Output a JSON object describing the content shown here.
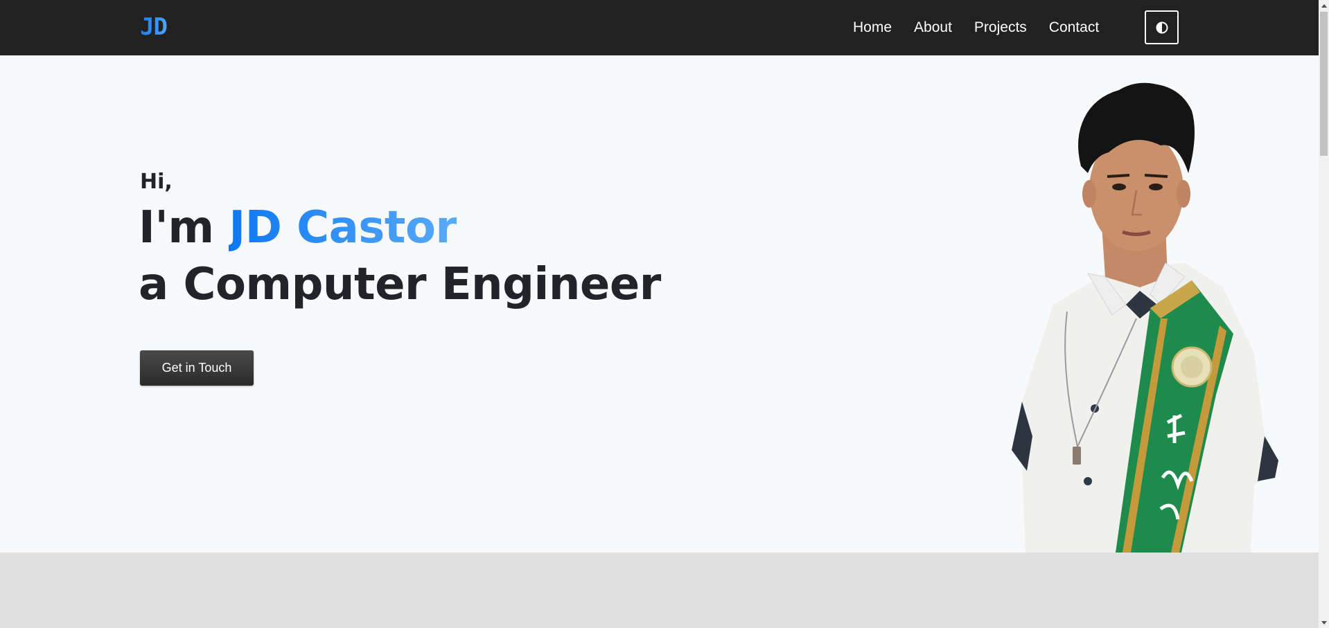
{
  "navbar": {
    "brand": "JD",
    "links": [
      "Home",
      "About",
      "Projects",
      "Contact"
    ],
    "theme_toggle_icon": "half-circle-contrast-icon"
  },
  "hero": {
    "greeting": "Hi,",
    "line1_prefix": "I'm ",
    "name": "JD Castor",
    "line2": "a Computer Engineer",
    "cta_label": "Get in Touch"
  },
  "colors": {
    "navbar_bg": "#212121",
    "accent_start": "#0d78f2",
    "accent_end": "#5aabf7",
    "hero_bg": "#f8f9fa",
    "next_section_bg": "#e0e0e0",
    "sash_green": "#1e8a4c"
  }
}
